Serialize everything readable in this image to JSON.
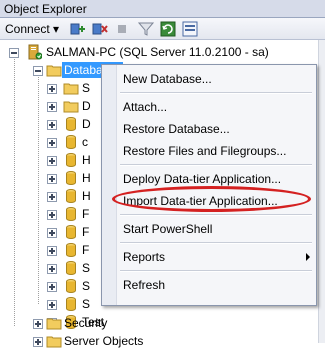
{
  "window": {
    "title": "Object Explorer"
  },
  "toolbar": {
    "connect_label": "Connect",
    "connect_arrow": "▾",
    "icons": [
      "connect-object-icon",
      "disconnect-icon",
      "stop-icon",
      "filter-icon",
      "refresh-icon",
      "summary-icon"
    ]
  },
  "tree": {
    "server": {
      "label": "SALMAN-PC (SQL Server 11.0.2100 - sa)",
      "icon": "server-icon"
    },
    "databases": {
      "label": "Databases",
      "icon": "folder-icon"
    },
    "children": [
      {
        "label": "S",
        "icon": "folder-icon"
      },
      {
        "label": "D",
        "icon": "folder-icon"
      },
      {
        "label": "D",
        "icon": "database-icon"
      },
      {
        "label": "c",
        "icon": "database-icon"
      },
      {
        "label": "H",
        "icon": "database-icon"
      },
      {
        "label": "H",
        "icon": "database-icon"
      },
      {
        "label": "H",
        "icon": "database-icon"
      },
      {
        "label": "F",
        "icon": "database-icon"
      },
      {
        "label": "F",
        "icon": "database-icon"
      },
      {
        "label": "F",
        "icon": "database-icon"
      },
      {
        "label": "S",
        "icon": "database-icon"
      },
      {
        "label": "S",
        "icon": "database-icon"
      },
      {
        "label": "S",
        "icon": "database-icon"
      },
      {
        "label": "Test",
        "icon": "database-icon"
      }
    ],
    "security": {
      "label": "Security",
      "icon": "folder-icon"
    },
    "server_objects": {
      "label": "Server Objects",
      "icon": "folder-icon"
    }
  },
  "context_menu": {
    "new_database": "New Database...",
    "attach": "Attach...",
    "restore_database": "Restore Database...",
    "restore_files": "Restore Files and Filegroups...",
    "deploy_data_tier": "Deploy Data-tier Application...",
    "import_data_tier": "Import Data-tier Application...",
    "start_powershell": "Start PowerShell",
    "reports": "Reports",
    "refresh": "Refresh"
  },
  "colors": {
    "selection": "#3399ff",
    "highlight_annotation": "#d42121",
    "folder": "#f2cc5e",
    "database": "#e8b630"
  }
}
